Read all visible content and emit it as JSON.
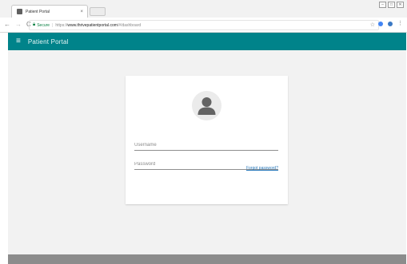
{
  "browser": {
    "tab": {
      "title": "Patient Portal",
      "close": "×"
    },
    "window_controls": [
      "–",
      "□",
      "✕"
    ],
    "nav": {
      "back": "←",
      "forward": "→",
      "reload": "C"
    },
    "address": {
      "secure_label": "Secure",
      "separator": "|",
      "protocol": "https://",
      "host": "www.thrivepatientportal.com",
      "path": "/#/dashboard"
    },
    "star": "☆",
    "extensions": {
      "more": "⋮"
    }
  },
  "appbar": {
    "menu_glyph": "≡",
    "title": "Patient Portal",
    "color": "#00838a"
  },
  "login": {
    "username": {
      "placeholder": "Username",
      "value": ""
    },
    "password": {
      "placeholder": "Password",
      "value": ""
    },
    "forgot_password": "Forgot password?"
  }
}
